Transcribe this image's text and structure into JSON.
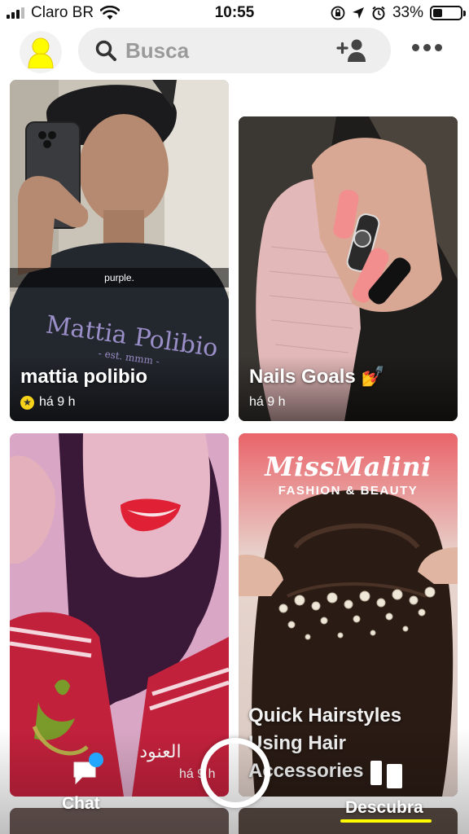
{
  "status_bar": {
    "carrier": "Claro BR",
    "time": "10:55",
    "battery": "33%",
    "battery_level": 0.33
  },
  "header": {
    "search_placeholder": "Busca"
  },
  "cards": [
    {
      "title": "mattia polibio",
      "time": "há 9 h",
      "caption": "purple.",
      "badge": "star",
      "shirt_text": "Mattia Polibio",
      "shirt_sub": "- est. mmm -"
    },
    {
      "title": "Nails Goals 💅",
      "time": "há 9 h"
    },
    {
      "overlay_text": "العنود",
      "time": "há 9 h"
    },
    {
      "brand": "MissMalini",
      "brand_sub": "FASHION & BEAUTY",
      "title": "Quick Hairstyles Using Hair Accessories"
    }
  ],
  "nav": {
    "chat_label": "Chat",
    "discover_label": "Descubra"
  },
  "colors": {
    "accent": "#fffc00",
    "chat_dot": "#22a6ff",
    "avatar": "#fffc00"
  }
}
